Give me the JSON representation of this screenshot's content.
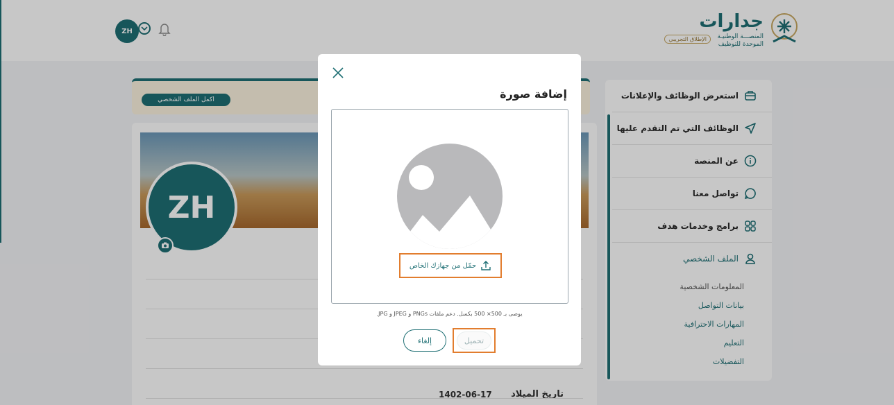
{
  "header": {
    "avatar_initials": "ZH",
    "logo_title": "جدارات",
    "logo_line1": "المنصـــة الوطنيـة",
    "logo_line2": "الموحدة للتوظيف",
    "logo_badge": "الإطلاق التجريبي"
  },
  "sidebar": {
    "items": [
      {
        "label": "استعرض الوظائف والإعلانات",
        "icon": "briefcase-icon"
      },
      {
        "label": "الوظائف التي تم التقدم عليها",
        "icon": "send-icon"
      },
      {
        "label": "عن المنصة",
        "icon": "info-icon"
      },
      {
        "label": "تواصل معنا",
        "icon": "chat-icon"
      },
      {
        "label": "برامج وخدمات هدف",
        "icon": "grid-icon"
      },
      {
        "label": "الملف الشخصي",
        "icon": "user-icon"
      }
    ],
    "subitems": [
      "المعلومات الشخصية",
      "بيانات التواصل",
      "المهارات الاحترافية",
      "التعليم",
      "التفضيلات"
    ]
  },
  "main": {
    "complete_profile_label": "اكمل الملف الشخصي",
    "avatar_initials": "ZH",
    "dob_label": "تاريخ الميلاد",
    "dob_value": "1402-06-17"
  },
  "modal": {
    "title": "إضافة صورة",
    "upload_link": "حمّل من جهازك الخاص",
    "hint": "يوصى بـ 500× 500 بكسل. دعم ملفات PNGs و JPEG و JPG.",
    "upload_button": "تحميل",
    "cancel_button": "إلغاء"
  },
  "colors": {
    "brand": "#1e6f74",
    "highlight": "#e27d2e",
    "placeholder_gray": "#b9b9bb"
  }
}
